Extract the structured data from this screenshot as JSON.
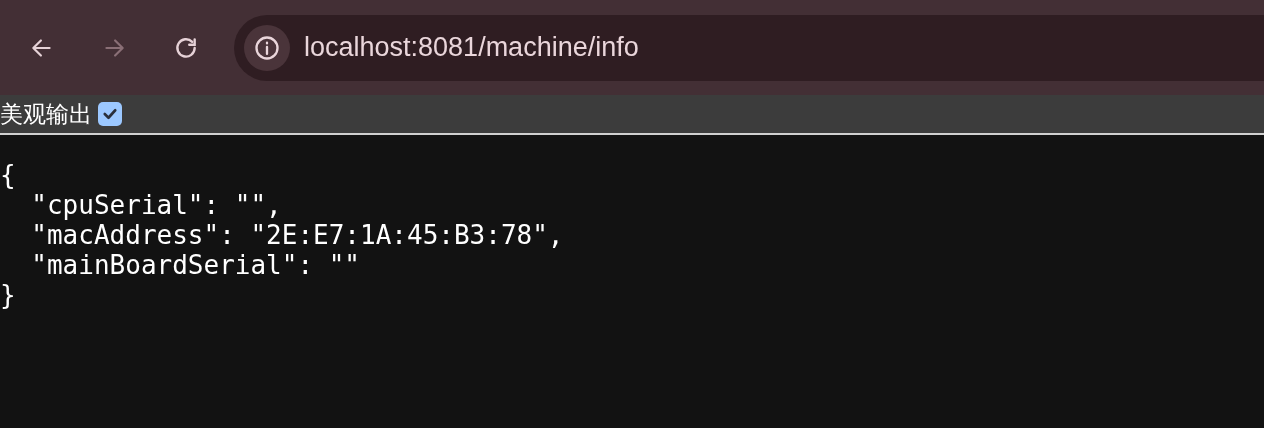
{
  "browser": {
    "back": {
      "disabled": false
    },
    "forward": {
      "disabled": true
    },
    "address": "localhost:8081/machine/info"
  },
  "pretty_print": {
    "label": "美观输出",
    "checked": true
  },
  "json_lines": [
    "{",
    "  \"cpuSerial\": \"\",",
    "  \"macAddress\": \"2E:E7:1A:45:B3:78\",",
    "  \"mainBoardSerial\": \"\"",
    "}"
  ]
}
